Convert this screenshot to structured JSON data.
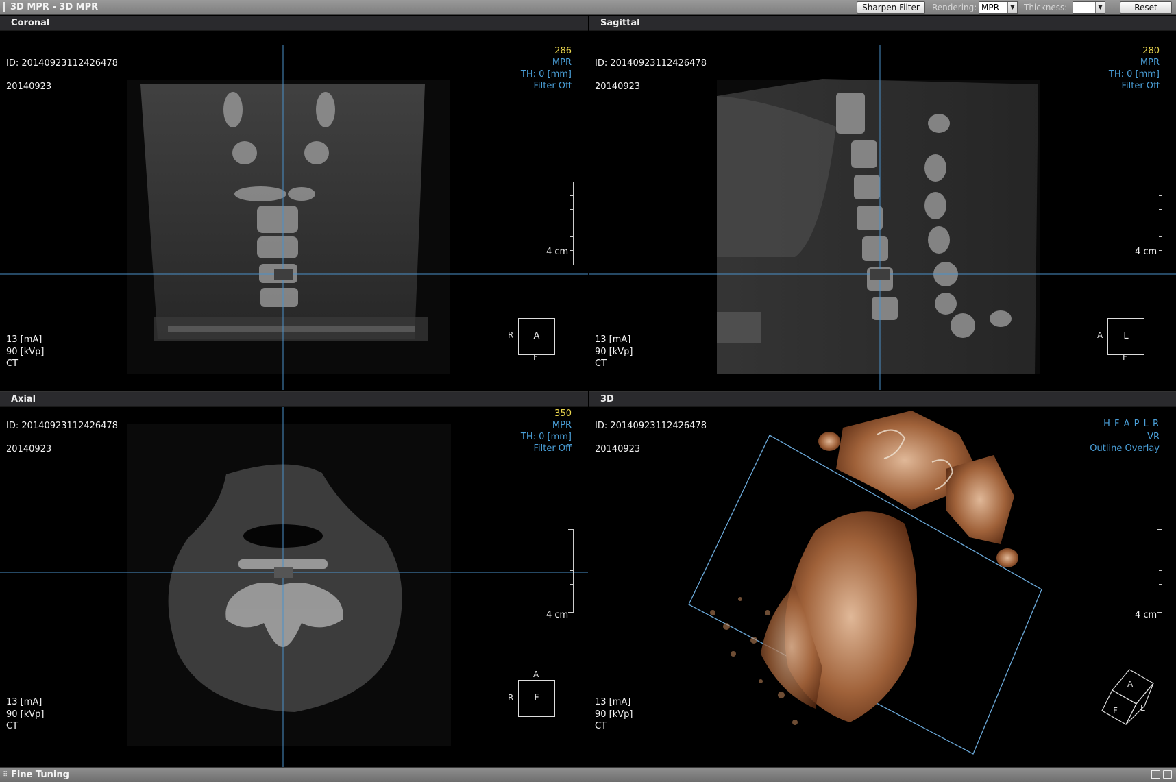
{
  "window": {
    "title": "3D MPR - 3D MPR"
  },
  "toolbar": {
    "sharpen_label": "Sharpen Filter",
    "rendering_label": "Rendering:",
    "rendering_value": "MPR",
    "thickness_label": "Thickness:",
    "thickness_value": "",
    "reset_label": "Reset"
  },
  "viewports": {
    "coronal": {
      "title": "Coronal",
      "id": "ID: 20140923112426478",
      "date": "20140923",
      "slice": "286",
      "mode": "MPR",
      "thickness": "TH: 0 [mm]",
      "filter": "Filter Off",
      "scale": "4 cm",
      "ma": "13 [mA]",
      "kvp": "90 [kVp]",
      "modality": "CT",
      "orient_box": "A",
      "orient_left": "R",
      "orient_bottom": "F"
    },
    "sagittal": {
      "title": "Sagittal",
      "id": "ID: 20140923112426478",
      "date": "20140923",
      "slice": "280",
      "mode": "MPR",
      "thickness": "TH: 0 [mm]",
      "filter": "Filter Off",
      "scale": "4 cm",
      "ma": "13 [mA]",
      "kvp": "90 [kVp]",
      "modality": "CT",
      "orient_box": "L",
      "orient_left": "A",
      "orient_bottom": "F"
    },
    "axial": {
      "title": "Axial",
      "id": "ID: 20140923112426478",
      "date": "20140923",
      "slice": "350",
      "mode": "MPR",
      "thickness": "TH: 0 [mm]",
      "filter": "Filter Off",
      "scale": "4 cm",
      "ma": "13 [mA]",
      "kvp": "90 [kVp]",
      "modality": "CT",
      "orient_box": "F",
      "orient_left": "R",
      "orient_top": "A"
    },
    "three_d": {
      "title": "3D",
      "id": "ID: 20140923112426478",
      "date": "20140923",
      "orientation": "H F A P L R",
      "render_mode": "VR",
      "overlay": "Outline Overlay",
      "scale": "4 cm",
      "ma": "13 [mA]",
      "kvp": "90 [kVp]",
      "modality": "CT",
      "cube_a": "A",
      "cube_f": "F",
      "cube_l": "L"
    }
  },
  "bottom": {
    "title": "Fine Tuning"
  },
  "colors": {
    "crosshair": "#4a90c8",
    "overlay_blue": "#4a9fd8",
    "slice_yellow": "#e8d44d",
    "bone_render": "#a0623a"
  }
}
